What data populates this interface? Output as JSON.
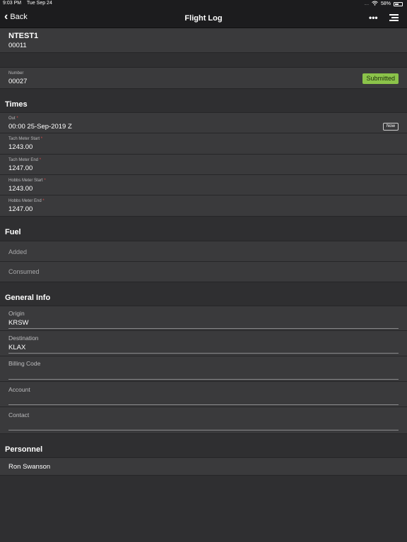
{
  "status_bar": {
    "time": "9:03 PM",
    "date": "Tue Sep 24",
    "battery": "58%"
  },
  "nav": {
    "back_label": "Back",
    "title": "Flight Log",
    "more_icon": "ellipsis-icon",
    "menu_icon": "list-menu-icon"
  },
  "header": {
    "tail": "NTEST1",
    "sub": "00011"
  },
  "number": {
    "label": "Number",
    "value": "00027",
    "status": "Submitted"
  },
  "times": {
    "title": "Times",
    "out_label": "Out",
    "out_value": "00:00 25-Sep-2019 Z",
    "now_label": "Now",
    "tach_start_label": "Tach Meter Start",
    "tach_start_value": "1243.00",
    "tach_end_label": "Tach Meter End",
    "tach_end_value": "1247.00",
    "hobbs_start_label": "Hobbs Meter Start",
    "hobbs_start_value": "1243.00",
    "hobbs_end_label": "Hobbs Meter End",
    "hobbs_end_value": "1247.00"
  },
  "fuel": {
    "title": "Fuel",
    "added": "Added",
    "consumed": "Consumed"
  },
  "general": {
    "title": "General Info",
    "origin_label": "Origin",
    "origin_value": "KRSW",
    "destination_label": "Destination",
    "destination_value": "KLAX",
    "billing_label": "Billing Code",
    "billing_value": "",
    "account_label": "Account",
    "account_value": "",
    "contact_label": "Contact",
    "contact_value": ""
  },
  "personnel": {
    "title": "Personnel",
    "name": "Ron Swanson"
  },
  "colors": {
    "status_badge": "#8bc34a",
    "required": "#d94a4a",
    "background": "#2f2f31",
    "row": "#3a3a3c"
  }
}
